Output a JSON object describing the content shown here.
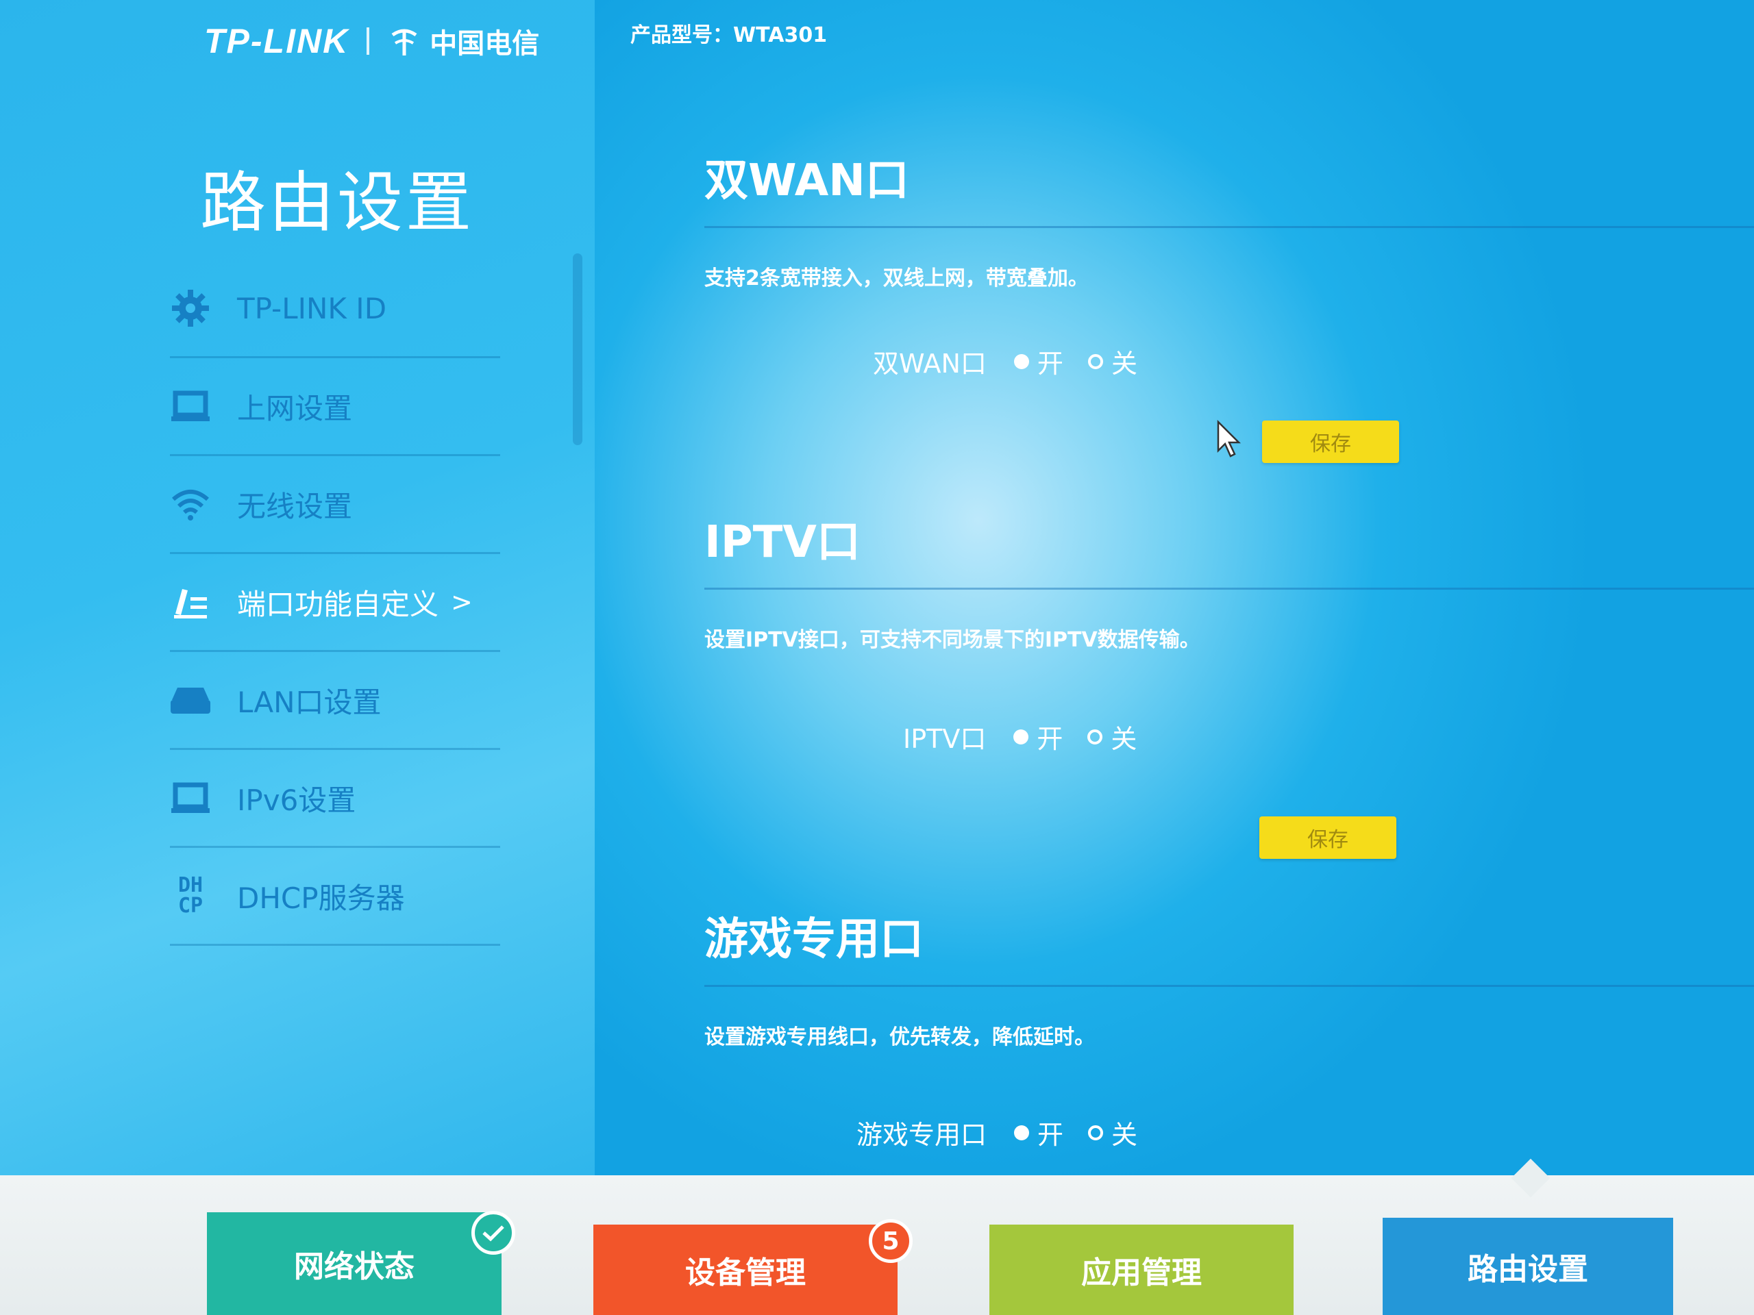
{
  "brand": {
    "tplink": "TP-LINK",
    "partner": "中国电信"
  },
  "sidebar": {
    "title": "路由设置",
    "items": [
      {
        "label": "TP-LINK ID",
        "icon": "gear-icon"
      },
      {
        "label": "上网设置",
        "icon": "monitor-icon"
      },
      {
        "label": "无线设置",
        "icon": "wifi-icon"
      },
      {
        "label": "端口功能自定义",
        "icon": "edit-list-icon",
        "active": true,
        "arrow": ">"
      },
      {
        "label": "LAN口设置",
        "icon": "router-icon"
      },
      {
        "label": "IPv6设置",
        "icon": "monitor-icon"
      },
      {
        "label": "DHCP服务器",
        "icon": "dhcp-icon",
        "icon_text": [
          "DH",
          "CP"
        ]
      }
    ]
  },
  "header": {
    "model": "产品型号：WTA301"
  },
  "sections": [
    {
      "title": "双WAN口",
      "desc": "支持2条宽带接入，双线上网，带宽叠加。",
      "toggle_label": "双WAN口",
      "on_label": "开",
      "off_label": "关",
      "selected": "on",
      "save_label": "保存"
    },
    {
      "title": "IPTV口",
      "desc": "设置IPTV接口，可支持不同场景下的IPTV数据传输。",
      "toggle_label": "IPTV口",
      "on_label": "开",
      "off_label": "关",
      "selected": "on",
      "save_label": "保存"
    },
    {
      "title": "游戏专用口",
      "desc": "设置游戏专用线口，优先转发，降低延时。",
      "toggle_label": "游戏专用口",
      "on_label": "开",
      "off_label": "关",
      "selected": "on"
    }
  ],
  "bottom_tabs": [
    {
      "label": "网络状态",
      "color": "#22b7a2",
      "badge": "check-icon"
    },
    {
      "label": "设备管理",
      "color": "#f2552a",
      "badge_count": "5"
    },
    {
      "label": "应用管理",
      "color": "#a4c73c"
    },
    {
      "label": "路由设置",
      "color": "#2497d8",
      "active": true
    }
  ],
  "colors": {
    "save_button": "#f5dc1a",
    "background": "#1aa8e6"
  }
}
